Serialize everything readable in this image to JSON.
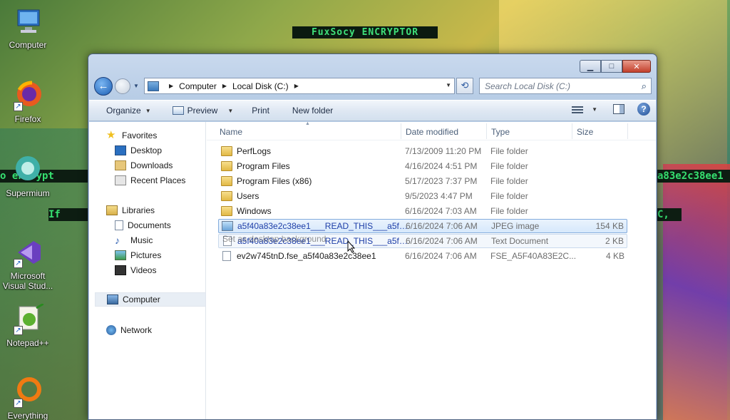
{
  "desktop": {
    "banner": "FuxSocy ENCRYPTOR",
    "ransom_strip1_left": "o  encrypt",
    "ransom_strip1_right": "a83e2c38ee1",
    "ransom_strip2_left": "If  ",
    "ransom_strip2_right": "C,",
    "icons": [
      {
        "label": "Computer"
      },
      {
        "label": "Firefox"
      },
      {
        "label": "Supermium"
      },
      {
        "label": "Microsoft Visual Stud..."
      },
      {
        "label": "Notepad++"
      },
      {
        "label": "Everything"
      }
    ]
  },
  "window": {
    "nav": {
      "breadcrumbs": [
        "Computer",
        "Local Disk (C:)"
      ],
      "search_placeholder": "Search Local Disk (C:)"
    },
    "toolbar": {
      "organize": "Organize",
      "preview": "Preview",
      "print": "Print",
      "new_folder": "New folder"
    },
    "sidebar": {
      "favorites": {
        "label": "Favorites",
        "items": [
          {
            "label": "Desktop"
          },
          {
            "label": "Downloads"
          },
          {
            "label": "Recent Places"
          }
        ]
      },
      "libraries": {
        "label": "Libraries",
        "items": [
          {
            "label": "Documents"
          },
          {
            "label": "Music"
          },
          {
            "label": "Pictures"
          },
          {
            "label": "Videos"
          }
        ]
      },
      "computer": {
        "label": "Computer"
      },
      "network": {
        "label": "Network"
      }
    },
    "columns": {
      "name": "Name",
      "date": "Date modified",
      "type": "Type",
      "size": "Size"
    },
    "files": [
      {
        "name": "PerfLogs",
        "date": "7/13/2009 11:20 PM",
        "type": "File folder",
        "size": ""
      },
      {
        "name": "Program Files",
        "date": "4/16/2024 4:51 PM",
        "type": "File folder",
        "size": ""
      },
      {
        "name": "Program Files (x86)",
        "date": "5/17/2023 7:37 PM",
        "type": "File folder",
        "size": ""
      },
      {
        "name": "Users",
        "date": "9/5/2023 4:47 PM",
        "type": "File folder",
        "size": ""
      },
      {
        "name": "Windows",
        "date": "6/16/2024 7:03 AM",
        "type": "File folder",
        "size": ""
      },
      {
        "name": "a5f40a83e2c38ee1___READ_THIS___a5f40a...",
        "date": "6/16/2024 7:06 AM",
        "type": "JPEG image",
        "size": "154 KB"
      },
      {
        "name": "a5f40a83e2c38ee1___READ_THIS___a5f40a...",
        "date": "6/16/2024 7:06 AM",
        "type": "Text Document",
        "size": "2 KB"
      },
      {
        "name": "ev2w745tnD.fse_a5f40a83e2c38ee1",
        "date": "6/16/2024 7:06 AM",
        "type": "FSE_A5F40A83E2C...",
        "size": "4 KB"
      }
    ],
    "drag_tooltip": "Set as desktop background"
  }
}
